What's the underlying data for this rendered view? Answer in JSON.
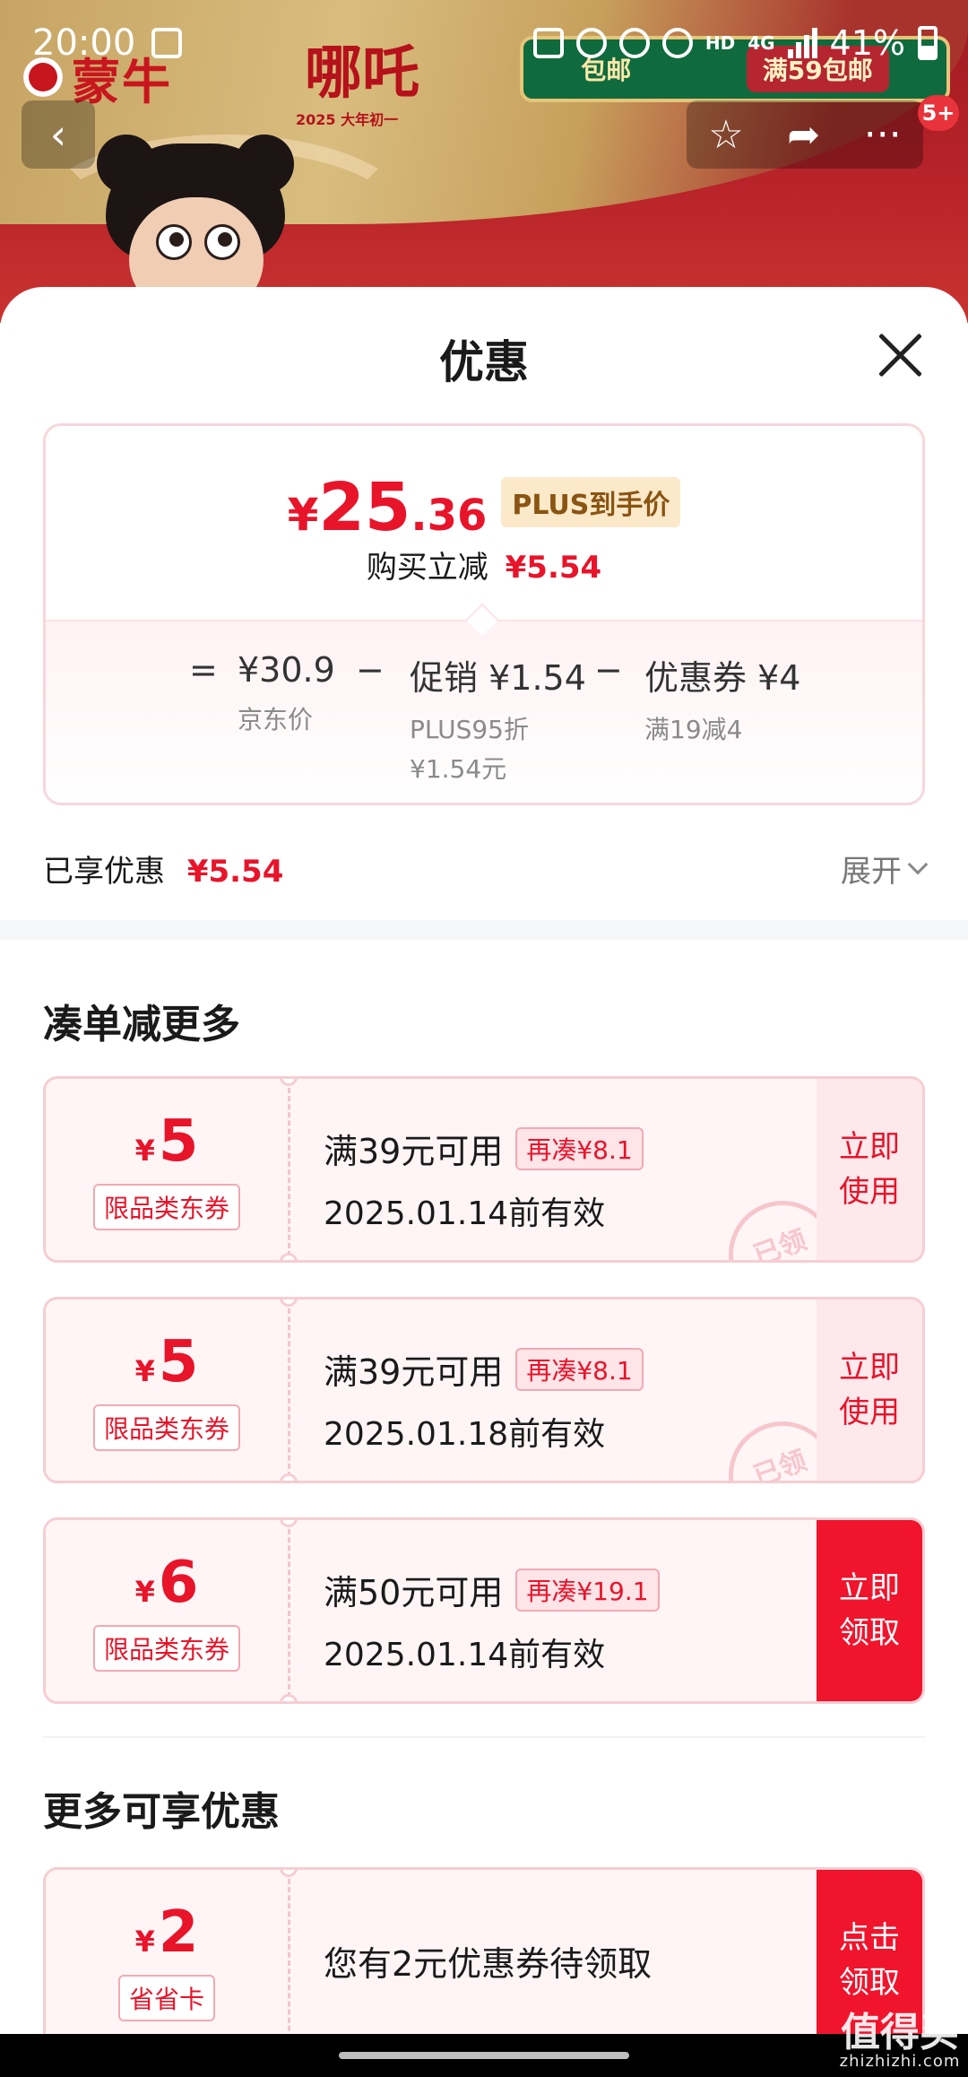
{
  "status_bar": {
    "time": "20:00",
    "network": "4G",
    "hd": "HD",
    "battery": "41%"
  },
  "background": {
    "brand": "蒙牛",
    "movie_title": "哪吒",
    "movie_date": "2025 大年初一",
    "promo_left": "包邮",
    "promo_right": "满59包邮"
  },
  "nav": {
    "back_icon": "‹",
    "star_icon": "☆",
    "share_icon": "➦",
    "more_icon": "···",
    "message_badge": "5+"
  },
  "sheet": {
    "title": "优惠",
    "price": {
      "yen": "¥",
      "integer": "25",
      "decimal": ".36",
      "plus_tag": "PLUS到手价",
      "save_label": "购买立减",
      "save_value": "¥5.54"
    },
    "calc": {
      "eq": "=",
      "jd_price": "¥30.9",
      "jd_price_label": "京东价",
      "minus": "−",
      "promo_label": "促销",
      "promo_value": "¥1.54",
      "promo_sub1": "PLUS95折",
      "promo_sub2": "¥1.54元",
      "coupon_label": "优惠券",
      "coupon_value": "¥4",
      "coupon_sub": "满19减4"
    },
    "enjoyed": {
      "label": "已享优惠",
      "value": "¥5.54",
      "expand": "展开"
    },
    "section_more": "凑单减更多",
    "coupons": [
      {
        "yen": "¥",
        "amount": "5",
        "tag": "限品类东券",
        "condition": "满39元可用",
        "more": "再凑¥8.1",
        "date": "2025.01.14前有效",
        "action_line1": "立即",
        "action_line2": "使用",
        "stamp": "已领"
      },
      {
        "yen": "¥",
        "amount": "5",
        "tag": "限品类东券",
        "condition": "满39元可用",
        "more": "再凑¥8.1",
        "date": "2025.01.18前有效",
        "action_line1": "立即",
        "action_line2": "使用",
        "stamp": "已领"
      },
      {
        "yen": "¥",
        "amount": "6",
        "tag": "限品类东券",
        "condition": "满50元可用",
        "more": "再凑¥19.1",
        "date": "2025.01.14前有效",
        "action_line1": "立即",
        "action_line2": "领取"
      }
    ],
    "section_enjoy": "更多可享优惠",
    "card": {
      "yen": "¥",
      "amount": "2",
      "tag": "省省卡",
      "text": "您有2元优惠券待领取",
      "action_line1": "点击",
      "action_line2": "领取"
    }
  },
  "watermark": {
    "main": "值得买",
    "sub": "zhizhizhi.com"
  },
  "colors": {
    "accent_red": "#e8142a",
    "button_red": "#f0142d",
    "coupon_bg": "#fff5f6"
  }
}
